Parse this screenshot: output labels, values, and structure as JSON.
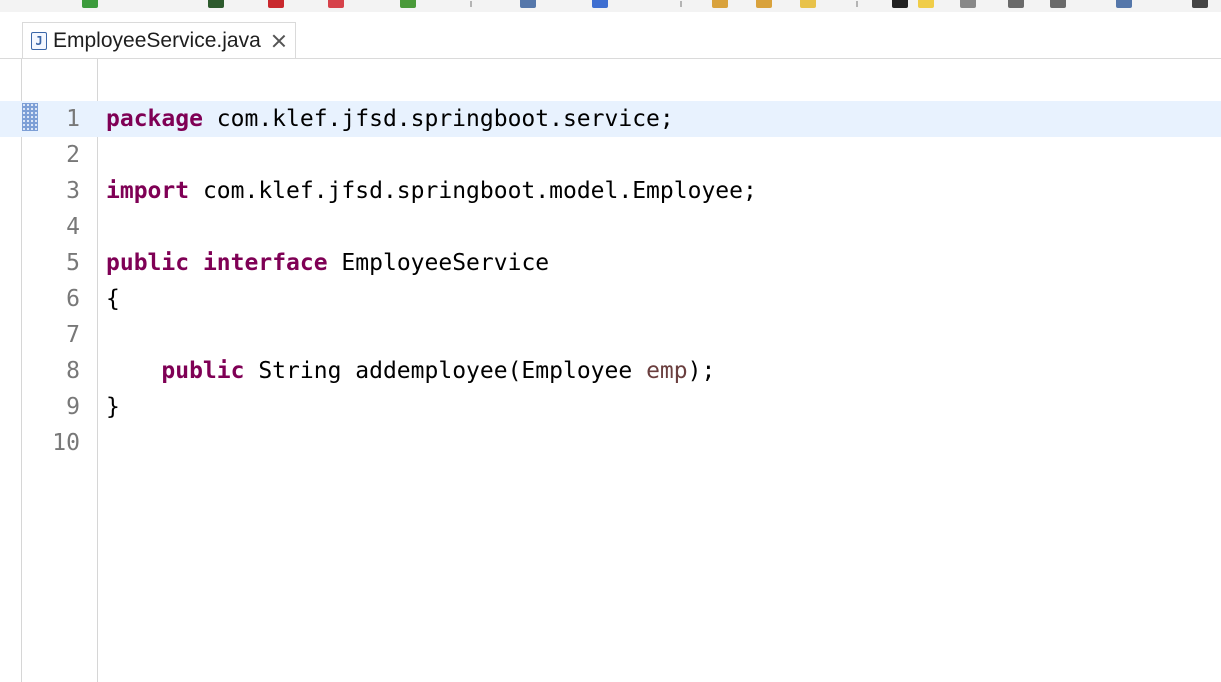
{
  "colors": {
    "keyword": "#7f0055",
    "variable": "#6a3e3e",
    "line_number": "#787878",
    "current_line_highlight": "#e8f2fe",
    "plain_text": "#000000"
  },
  "toolbar": {
    "icons": [
      {
        "name": "run-icon",
        "color": "#3c9b3c"
      },
      {
        "name": "debug-icon",
        "color": "#2d5a2d"
      },
      {
        "name": "stop-icon",
        "color": "#c9282d"
      },
      {
        "name": "terminate-icon",
        "color": "#d6424a"
      },
      {
        "name": "coverage-icon",
        "color": "#4a9a3a"
      },
      {
        "name": "globe-icon",
        "color": "#5577aa"
      },
      {
        "name": "search-icon",
        "color": "#3f6fd1"
      },
      {
        "name": "folder-icon",
        "color": "#d9a23c"
      },
      {
        "name": "open-folder-icon",
        "color": "#d9a23c"
      },
      {
        "name": "pencil-icon",
        "color": "#e8c24a"
      },
      {
        "name": "next-annotation-icon",
        "color": "#222222"
      },
      {
        "name": "prev-annotation-icon",
        "color": "#f0cd48"
      },
      {
        "name": "dropdown-icon",
        "color": "#888888"
      },
      {
        "name": "back-icon",
        "color": "#6a6a6a"
      },
      {
        "name": "forward-icon",
        "color": "#6a6a6a"
      },
      {
        "name": "pin-icon",
        "color": "#5577aa"
      },
      {
        "name": "more-icon",
        "color": "#444444"
      }
    ]
  },
  "tab": {
    "file_icon": "java-file-icon",
    "file_icon_glyph": "J",
    "title": "EmployeeService.java",
    "close_icon": "close-icon"
  },
  "editor": {
    "current_line": 1,
    "lines": [
      {
        "number": "1",
        "tokens": [
          {
            "t": "package",
            "c": "kw"
          },
          {
            "t": " com.klef.jfsd.springboot.service;",
            "c": ""
          }
        ]
      },
      {
        "number": "2",
        "tokens": []
      },
      {
        "number": "3",
        "tokens": [
          {
            "t": "import",
            "c": "kw"
          },
          {
            "t": " com.klef.jfsd.springboot.model.Employee;",
            "c": ""
          }
        ]
      },
      {
        "number": "4",
        "tokens": []
      },
      {
        "number": "5",
        "tokens": [
          {
            "t": "public",
            "c": "kw"
          },
          {
            "t": " ",
            "c": ""
          },
          {
            "t": "interface",
            "c": "kw"
          },
          {
            "t": " EmployeeService",
            "c": ""
          }
        ]
      },
      {
        "number": "6",
        "tokens": [
          {
            "t": "{",
            "c": ""
          }
        ]
      },
      {
        "number": "7",
        "tokens": []
      },
      {
        "number": "8",
        "tokens": [
          {
            "t": "    ",
            "c": ""
          },
          {
            "t": "public",
            "c": "kw"
          },
          {
            "t": " String addemployee(Employee ",
            "c": ""
          },
          {
            "t": "emp",
            "c": "var"
          },
          {
            "t": ");",
            "c": ""
          }
        ]
      },
      {
        "number": "9",
        "tokens": [
          {
            "t": "}",
            "c": ""
          }
        ]
      },
      {
        "number": "10",
        "tokens": []
      }
    ]
  }
}
